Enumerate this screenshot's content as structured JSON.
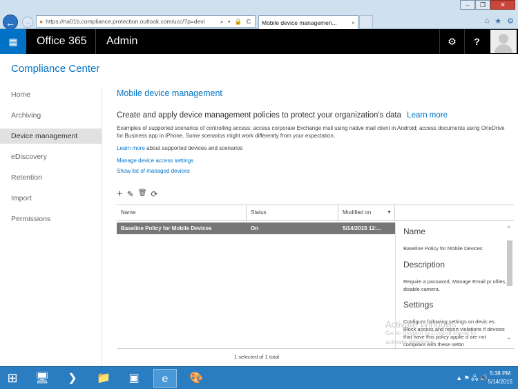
{
  "browser": {
    "url": "https://na01b.compliance.protection.outlook.com/ucc/?p=devi",
    "tab_title": "Mobile device managemen...",
    "tab_close": "×",
    "address_icons": "⌕ ▾ 🔒 C",
    "win_minimize": "–",
    "win_restore": "❐",
    "win_close": "✕",
    "back": "←",
    "forward": "→",
    "home_icon": "⌂",
    "fav_icon": "★",
    "tools_icon": "⚙"
  },
  "header": {
    "waffle": "▦",
    "brand": "Office 365",
    "section": "Admin",
    "settings_icon": "⚙",
    "help": "?"
  },
  "page": {
    "title": "Compliance Center",
    "nav": [
      "Home",
      "Archiving",
      "Device management",
      "eDiscovery",
      "Retention",
      "Import",
      "Permissions"
    ],
    "content_title": "Mobile device management",
    "headline": "Create and apply device management policies to protect your organization's data",
    "headline_link": "Learn more",
    "description": "Examples of supported scenarios of controlling access: access corporate Exchange mail using native mail client in Android; access documents using OneDrive for Business app in iPhone. Some scenarios might work differently from your expectation.",
    "learn_more": "Learn more",
    "learn_more_rest": " about supported devices and scenarios",
    "link_manage": "Manage device access settings",
    "link_show": "Show list of managed devices"
  },
  "toolbar": {
    "add": "+",
    "edit": "✎",
    "delete": "🗑",
    "refresh": "⟳"
  },
  "grid": {
    "columns": [
      "Name",
      "Status",
      "Modified on"
    ],
    "sort_icon": "▼",
    "rows": [
      {
        "name": "Baseline Policy for Mobile Devices",
        "status": "On",
        "modified": "5/14/2015 12:..."
      }
    ],
    "footer": "1 selected of 1 total"
  },
  "details": {
    "name_h": "Name",
    "name_v": "Baseline Policy for Mobile Devices",
    "desc_h": "Description",
    "desc_v": "Require a password, Manage Email pr ofiles, disable camera.",
    "settings_h": "Settings",
    "settings_v": "Configure following settings on devic es. Block access and report violations if devices that have this policy applie d are not compliant with these settin",
    "scroll_up": "⌃",
    "scroll_down": "⌄"
  },
  "watermark": {
    "line1": "Activate Windows",
    "line2": "Go to System in Control Panel to",
    "line3": "activate Windows."
  },
  "taskbar": {
    "start": "⊞",
    "apps": [
      "🖥",
      "❯",
      "📁",
      "▣",
      "e",
      "🎨"
    ],
    "tray": "▲ ⚑ 🖧 🔊",
    "time": "5:38 PM",
    "date": "5/14/2015"
  }
}
